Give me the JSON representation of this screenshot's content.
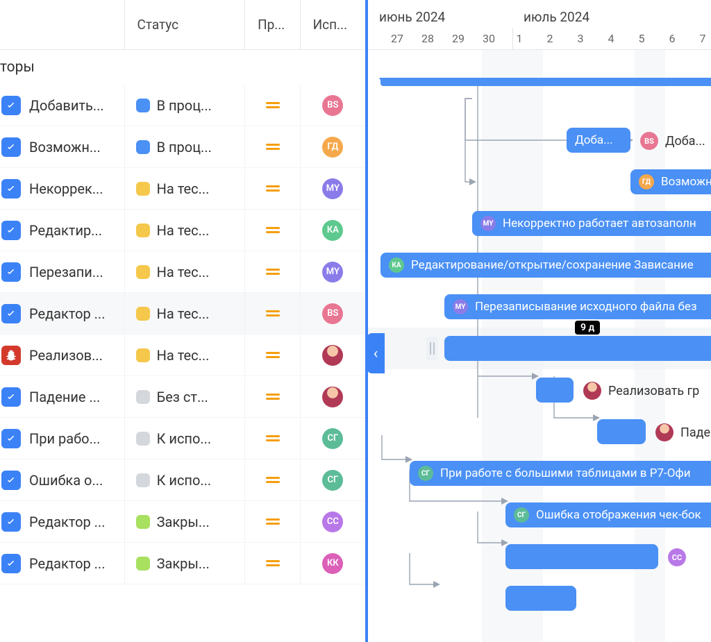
{
  "columns": {
    "name": "",
    "status": "Статус",
    "priority": "Пр...",
    "executor": "Исп..."
  },
  "months": {
    "june": "июнь 2024",
    "july": "июль 2024"
  },
  "days": [
    "",
    "27",
    "28",
    "29",
    "30",
    "1",
    "2",
    "3",
    "4",
    "5",
    "6",
    "7"
  ],
  "group": {
    "name": "торы"
  },
  "duration_badge": "9 д",
  "statuses": {
    "in_progress": "В проц...",
    "testing": "На тес...",
    "none": "Без ст...",
    "todo": "К испо...",
    "closed": "Закры..."
  },
  "tasks": [
    {
      "id": 0,
      "type": "task",
      "name": "Добавить...",
      "status": "in_progress",
      "status_color": "blue",
      "exec": "BS",
      "exec_color": "pink",
      "bar_label": "Доба...",
      "bar_start": 286,
      "bar_end": 378,
      "after_av": "BS",
      "after_av_color": "pink"
    },
    {
      "id": 1,
      "type": "task",
      "name": "Возможн...",
      "status": "in_progress",
      "status_color": "blue",
      "exec": "ГД",
      "exec_color": "orange",
      "bar_label": "Возможн",
      "bar_start": 378,
      "bar_end": 700,
      "inline_av": "ГД",
      "inline_av_color": "orange",
      "mini_outside": true
    },
    {
      "id": 2,
      "type": "task",
      "name": "Некоррек...",
      "status": "testing",
      "status_color": "yellow",
      "exec": "MY",
      "exec_color": "violet",
      "bar_label": "Некорректно работает автозаполн",
      "bar_start": 150,
      "bar_end": 700,
      "inline_av": "MY",
      "inline_av_color": "violet"
    },
    {
      "id": 3,
      "type": "task",
      "name": "Редактир...",
      "status": "testing",
      "status_color": "yellow",
      "exec": "КА",
      "exec_color": "green",
      "bar_label": "Редактирование/открытие/сохранение Зависание",
      "bar_start": 18,
      "bar_end": 700,
      "inline_av": "КА",
      "inline_av_color": "green"
    },
    {
      "id": 4,
      "type": "task",
      "name": "Перезапи...",
      "status": "testing",
      "status_color": "yellow",
      "exec": "MY",
      "exec_color": "violet",
      "bar_label": "Перезаписывание исходного файла без",
      "bar_start": 110,
      "bar_end": 700,
      "inline_av": "MY",
      "inline_av_color": "violet"
    },
    {
      "id": 5,
      "type": "task",
      "name": "Редактор ...",
      "status": "testing",
      "status_color": "yellow",
      "exec": "BS",
      "exec_color": "pink",
      "bar_label": "",
      "bar_start": 110,
      "bar_end": 700,
      "hover": true,
      "drag": true
    },
    {
      "id": 6,
      "type": "bug",
      "name": "Реализов...",
      "status": "testing",
      "status_color": "yellow",
      "exec": "",
      "exec_color": "photo",
      "bar_label": "Реализовать гр",
      "bar_start": 242,
      "bar_end": 296,
      "short": true,
      "after_photo": true
    },
    {
      "id": 7,
      "type": "task",
      "name": "Падение ...",
      "status": "none",
      "status_color": "grey",
      "exec": "",
      "exec_color": "photo",
      "bar_label": "Паде",
      "bar_start": 330,
      "bar_end": 400,
      "short": true,
      "after_photo": true
    },
    {
      "id": 8,
      "type": "task",
      "name": "При рабо...",
      "status": "todo",
      "status_color": "grey",
      "exec": "СГ",
      "exec_color": "teal",
      "bar_label": "При работе с большими таблицами в Р7-Офи",
      "bar_start": 60,
      "bar_end": 700,
      "inline_av": "СГ",
      "inline_av_color": "teal"
    },
    {
      "id": 9,
      "type": "task",
      "name": "Ошибка о...",
      "status": "todo",
      "status_color": "grey",
      "exec": "СГ",
      "exec_color": "teal",
      "bar_label": "Ошибка отображения чек-бок",
      "bar_start": 198,
      "bar_end": 700,
      "inline_av": "СГ",
      "inline_av_color": "teal"
    },
    {
      "id": 10,
      "type": "task",
      "name": "Редактор ...",
      "status": "closed",
      "status_color": "green",
      "exec": "СС",
      "exec_color": "purple",
      "bar_label": "",
      "bar_start": 198,
      "bar_end": 418,
      "short": true,
      "after_av": "СС",
      "after_av_color": "purple",
      "after_far": true
    },
    {
      "id": 11,
      "type": "task",
      "name": "Редактор ...",
      "status": "closed",
      "status_color": "green",
      "exec": "КК",
      "exec_color": "mag",
      "bar_label": "",
      "bar_start": 198,
      "bar_end": 300,
      "short": true
    }
  ]
}
